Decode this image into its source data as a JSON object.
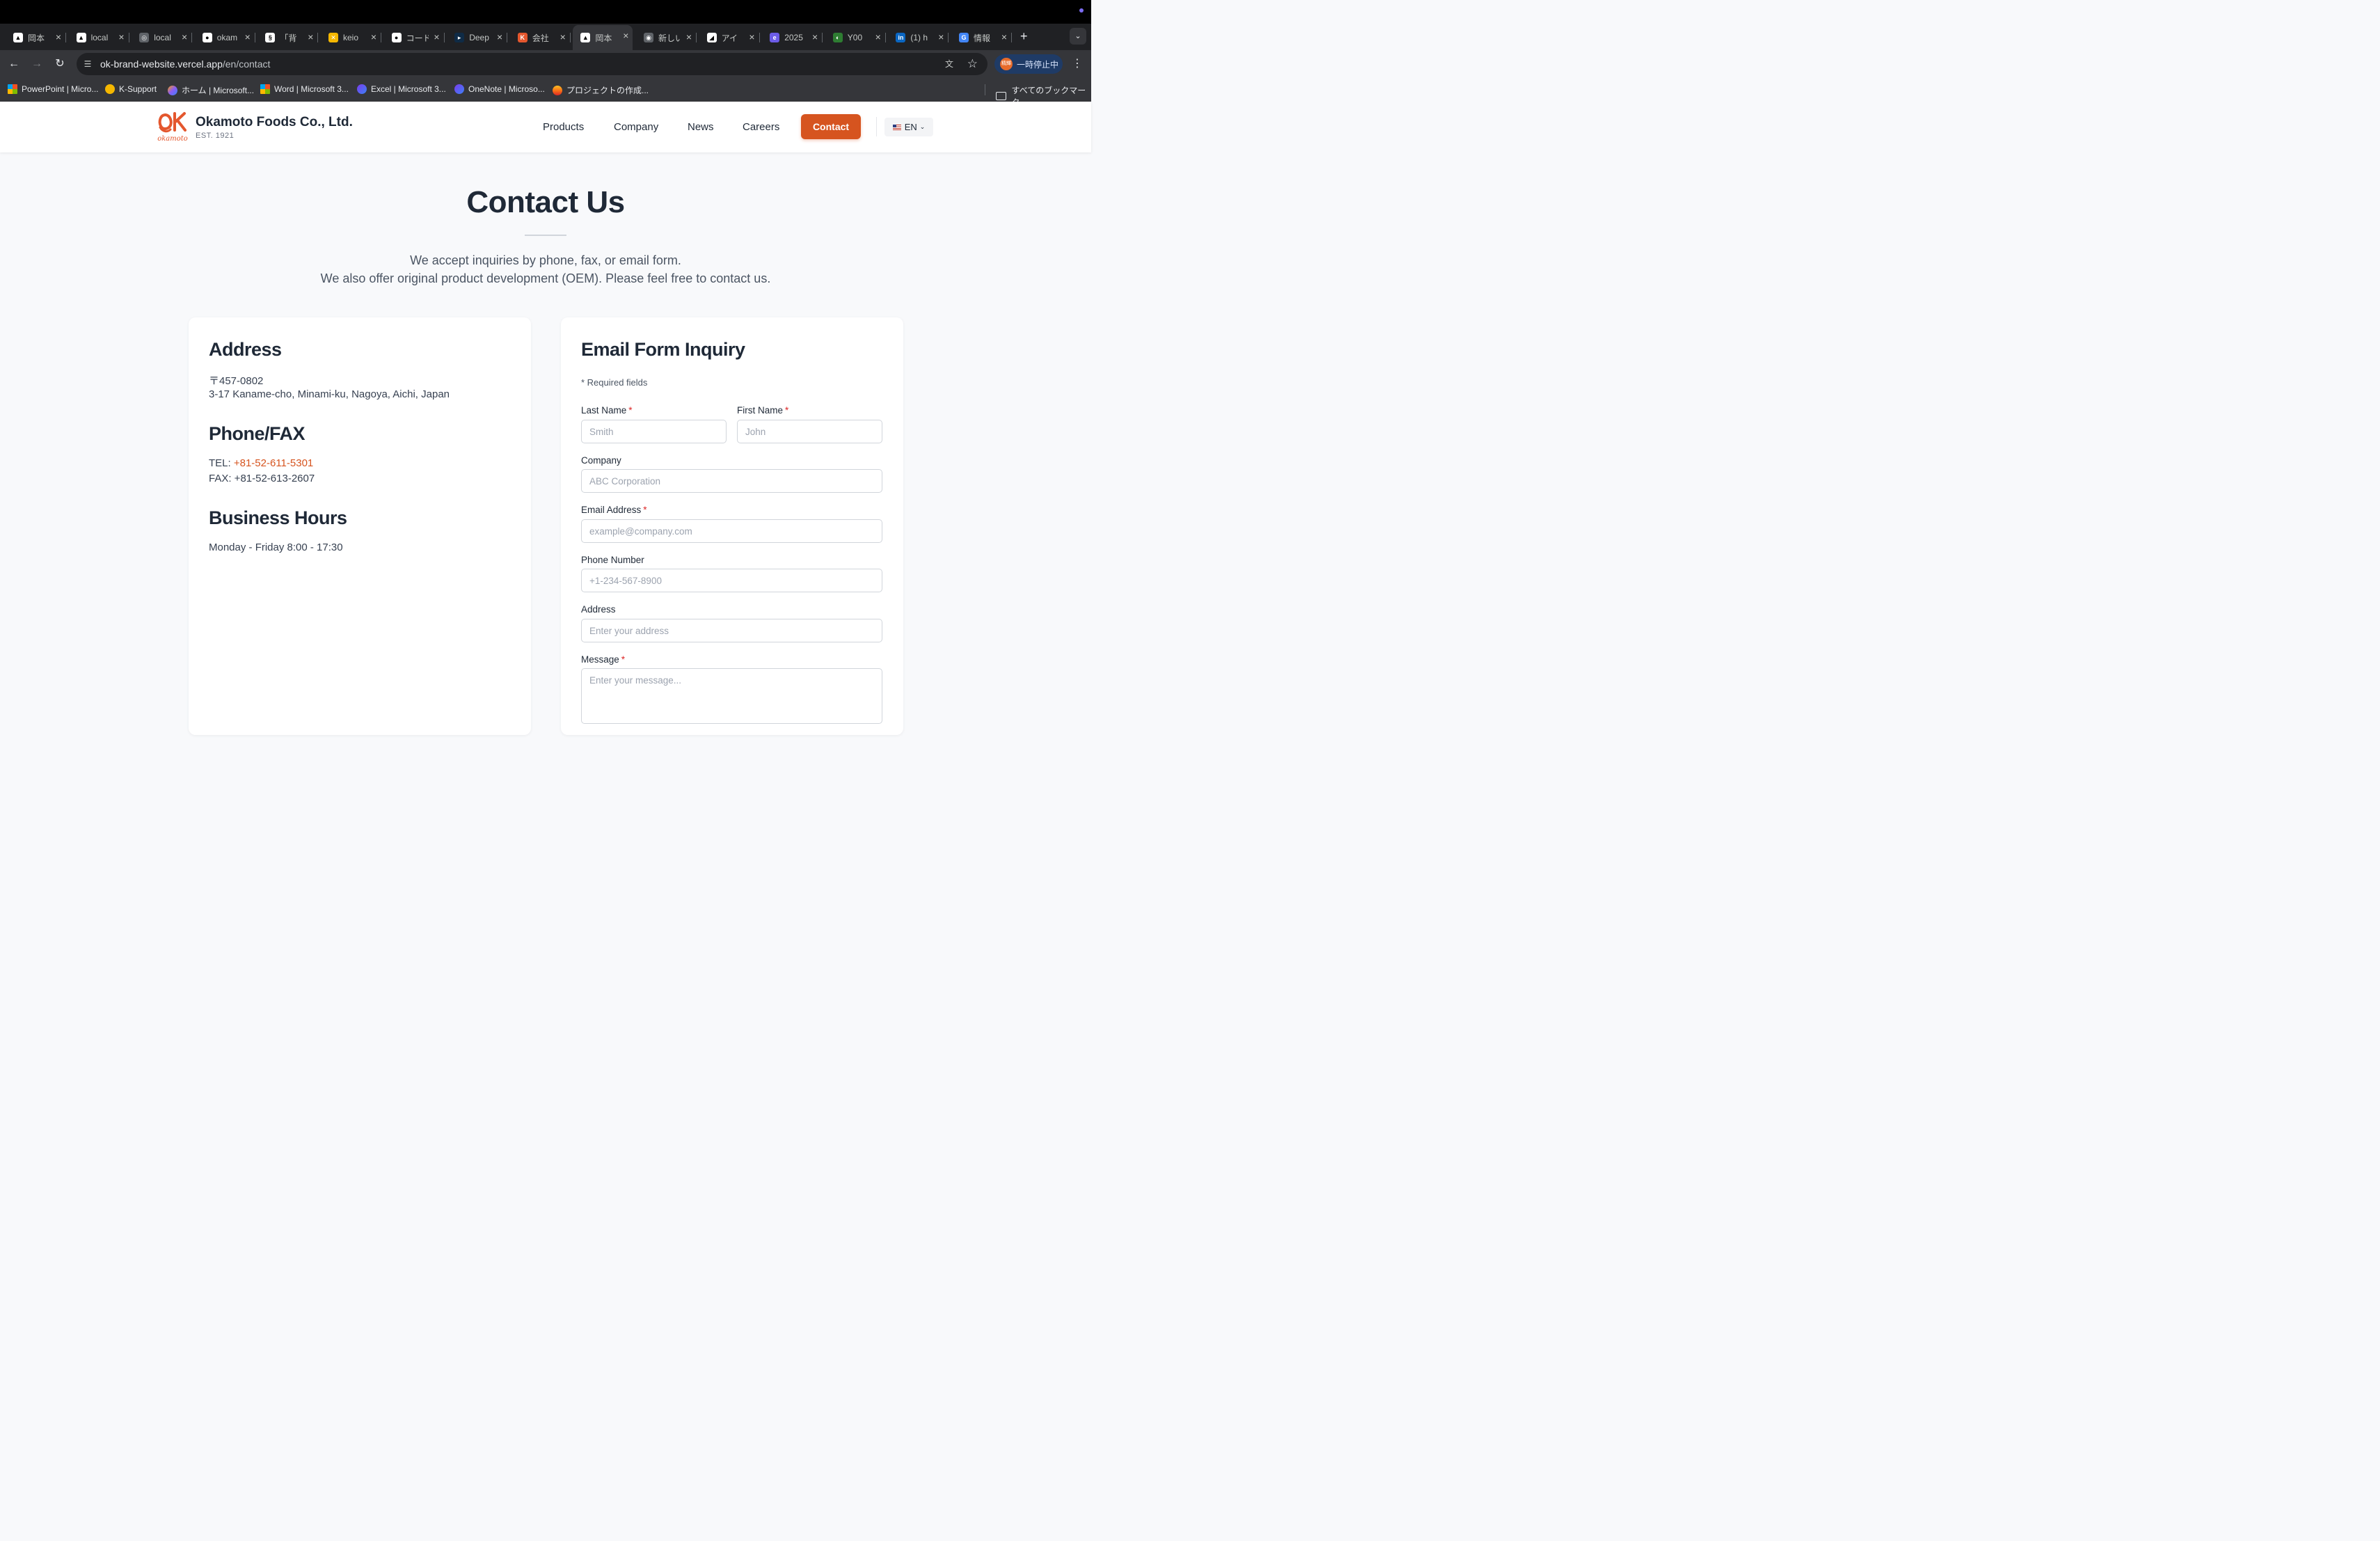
{
  "browser": {
    "tabs": [
      {
        "title": "岡本",
        "icon": "vercel-triangle-icon",
        "color": "#000000"
      },
      {
        "title": "local",
        "icon": "vercel-triangle-icon",
        "color": "#000000"
      },
      {
        "title": "local",
        "icon": "globe-icon",
        "color": "#5f6368"
      },
      {
        "title": "okam",
        "icon": "github-icon",
        "color": "#000000"
      },
      {
        "title": "「背",
        "icon": "section-icon",
        "color": "#000000"
      },
      {
        "title": "keio",
        "icon": "keio-x-icon",
        "color": "#f5b700"
      },
      {
        "title": "コード",
        "icon": "github-icon",
        "color": "#000000"
      },
      {
        "title": "Deep",
        "icon": "deepl-icon",
        "color": "#0f2b46"
      },
      {
        "title": "会社",
        "icon": "ok-logo-icon",
        "color": "#e4572e"
      },
      {
        "title": "岡本",
        "icon": "vercel-triangle-icon",
        "color": "#000000",
        "active": true
      },
      {
        "title": "新しい",
        "icon": "chrome-icon",
        "color": "#5f6368"
      },
      {
        "title": "アイ",
        "icon": "app-icon",
        "color": "#000000"
      },
      {
        "title": "2025",
        "icon": "e-icon",
        "color": "#6c5ce7"
      },
      {
        "title": "Y00",
        "icon": "leaf-icon",
        "color": "#2e7d32"
      },
      {
        "title": "(1) h",
        "icon": "linkedin-icon",
        "color": "#0a66c2"
      },
      {
        "title": "情報",
        "icon": "google-icon",
        "color": "#4285f4"
      }
    ],
    "new_tab_label": "+",
    "url_host": "ok-brand-website.vercel.app",
    "url_path": "/en/contact",
    "profile_label": "一時停止中",
    "profile_avatar_text": "精輝",
    "bookmarks": [
      {
        "label": "PowerPoint | Micro...",
        "icon": "ms-logo-icon"
      },
      {
        "label": "K-Support",
        "icon": "keio-x-icon"
      },
      {
        "label": "ホーム | Microsoft...",
        "icon": "copilot-icon"
      },
      {
        "label": "Word | Microsoft 3...",
        "icon": "ms-logo-icon"
      },
      {
        "label": "Excel | Microsoft 3...",
        "icon": "loop-icon"
      },
      {
        "label": "OneNote | Microso...",
        "icon": "loop-icon"
      },
      {
        "label": "プロジェクトの作成...",
        "icon": "firebase-icon"
      }
    ],
    "all_bookmarks_label": "すべてのブックマーク"
  },
  "header": {
    "brand_name": "Okamoto Foods Co., Ltd.",
    "brand_est": "EST. 1921",
    "logo_text": "okamoto",
    "nav": [
      "Products",
      "Company",
      "News",
      "Careers"
    ],
    "contact_label": "Contact",
    "lang_label": "EN",
    "brand_color": "#d6541f"
  },
  "hero": {
    "title": "Contact Us",
    "line1": "We accept inquiries by phone, fax, or email form.",
    "line2": "We also offer original product development (OEM). Please feel free to contact us."
  },
  "info": {
    "address_heading": "Address",
    "postal": "〒457-0802",
    "address": "3-17 Kaname-cho, Minami-ku, Nagoya, Aichi, Japan",
    "phone_heading": "Phone/FAX",
    "tel_label": "TEL: ",
    "tel": "+81-52-611-5301",
    "fax": "FAX: +81-52-613-2607",
    "hours_heading": "Business Hours",
    "hours": "Monday - Friday 8:00 - 17:30"
  },
  "form": {
    "heading": "Email Form Inquiry",
    "required_note": "* Required fields",
    "last_name_label": "Last Name",
    "last_name_placeholder": "Smith",
    "first_name_label": "First Name",
    "first_name_placeholder": "John",
    "company_label": "Company",
    "company_placeholder": "ABC Corporation",
    "email_label": "Email Address",
    "email_placeholder": "example@company.com",
    "phone_label": "Phone Number",
    "phone_placeholder": "+1-234-567-8900",
    "address_label": "Address",
    "address_placeholder": "Enter your address",
    "message_label": "Message",
    "message_placeholder": "Enter your message...",
    "required_mark": "*"
  }
}
